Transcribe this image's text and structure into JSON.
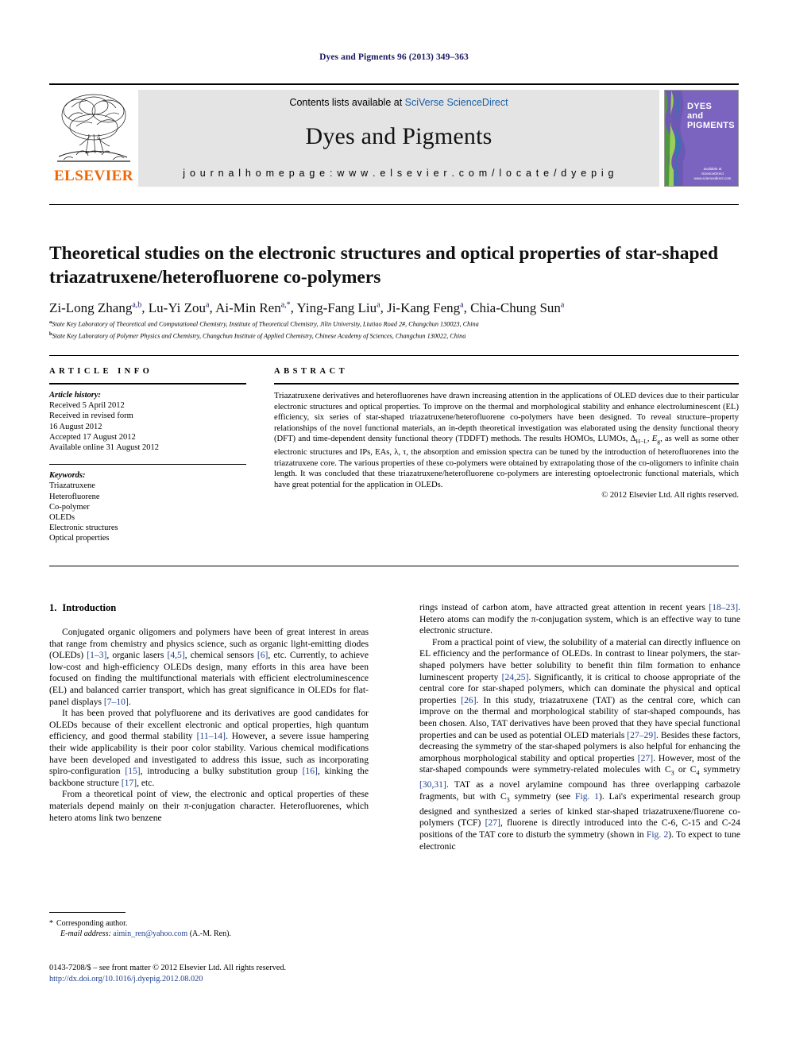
{
  "running_head": "Dyes and Pigments 96 (2013) 349–363",
  "masthead": {
    "publisher_name": "ELSEVIER",
    "contents_prefix": "Contents lists available at ",
    "contents_link": "SciVerse ScienceDirect",
    "journal_title": "Dyes and Pigments",
    "homepage": "j o u r n a l   h o m e p a g e :   w w w . e l s e v i e r . c o m / l o c a t e / d y e p i g",
    "cover": {
      "line1": "DYES",
      "line2": "and",
      "line3": "PIGMENTS",
      "badge_top": "available at",
      "badge_main": "ScienceDirect",
      "badge_url": "www.sciencedirect.com",
      "background_color": "#7b63c0"
    }
  },
  "title": "Theoretical studies on the electronic structures and optical properties of star-shaped triazatruxene/heterofluorene co-polymers",
  "authors": [
    {
      "name": "Zi-Long Zhang",
      "marks": "a,b"
    },
    {
      "name": "Lu-Yi Zou",
      "marks": "a"
    },
    {
      "name": "Ai-Min Ren",
      "marks": "a,*"
    },
    {
      "name": "Ying-Fang Liu",
      "marks": "a"
    },
    {
      "name": "Ji-Kang Feng",
      "marks": "a"
    },
    {
      "name": "Chia-Chung Sun",
      "marks": "a"
    }
  ],
  "affiliations": [
    {
      "mark": "a",
      "text": "State Key Laboratory of Theoretical and Computational Chemistry, Institute of Theoretical Chemistry, Jilin University, Liutiao Road 2#, Changchun 130023, China"
    },
    {
      "mark": "b",
      "text": "State Key Laboratory of Polymer Physics and Chemistry, Changchun Institute of Applied Chemistry, Chinese Academy of Sciences, Changchun 130022, China"
    }
  ],
  "article_info": {
    "heading": "ARTICLE INFO",
    "history_label": "Article history:",
    "history": [
      "Received 5 April 2012",
      "Received in revised form",
      "16 August 2012",
      "Accepted 17 August 2012",
      "Available online 31 August 2012"
    ],
    "keywords_label": "Keywords:",
    "keywords": [
      "Triazatruxene",
      "Heterofluorene",
      "Co-polymer",
      "OLEDs",
      "Electronic structures",
      "Optical properties"
    ]
  },
  "abstract": {
    "heading": "ABSTRACT",
    "text": "Triazatruxene derivatives and heterofluorenes have drawn increasing attention in the applications of OLED devices due to their particular electronic structures and optical properties. To improve on the thermal and morphological stability and enhance electroluminescent (EL) efficiency, six series of star-shaped triazatruxene/heterofluorene co-polymers have been designed. To reveal structure–property relationships of the novel functional materials, an in-depth theoretical investigation was elaborated using the density functional theory (DFT) and time-dependent density functional theory (TDDFT) methods. The results HOMOs, LUMOs, ΔH−L, Eg, as well as some other electronic structures and IPs, EAs, λ, τ, the absorption and emission spectra can be tuned by the introduction of heterofluorenes into the triazatruxene core. The various properties of these co-polymers were obtained by extrapolating those of the co-oligomers to infinite chain length. It was concluded that these triazatruxene/heterofluorene co-polymers are interesting optoelectronic functional materials, which have great potential for the application in OLEDs.",
    "copyright": "© 2012 Elsevier Ltd. All rights reserved."
  },
  "sections": {
    "intro_number": "1.",
    "intro_title": "Introduction"
  },
  "body_left": [
    "Conjugated organic oligomers and polymers have been of great interest in areas that range from chemistry and physics science, such as organic light-emitting diodes (OLEDs) [1–3], organic lasers [4,5], chemical sensors [6], etc. Currently, to achieve low-cost and high-efficiency OLEDs design, many efforts in this area have been focused on finding the multifunctional materials with efficient electroluminescence (EL) and balanced carrier transport, which has great significance in OLEDs for flat-panel displays [7–10].",
    "It has been proved that polyfluorene and its derivatives are good candidates for OLEDs because of their excellent electronic and optical properties, high quantum efficiency, and good thermal stability [11–14]. However, a severe issue hampering their wide applicability is their poor color stability. Various chemical modifications have been developed and investigated to address this issue, such as incorporating spiro-configuration [15], introducing a bulky substitution group [16], kinking the backbone structure [17], etc.",
    "From a theoretical point of view, the electronic and optical properties of these materials depend mainly on their π-conjugation character. Heterofluorenes, which hetero atoms link two benzene"
  ],
  "body_right": [
    "rings instead of carbon atom, have attracted great attention in recent years [18–23]. Hetero atoms can modify the π-conjugation system, which is an effective way to tune electronic structure.",
    "From a practical point of view, the solubility of a material can directly influence on EL efficiency and the performance of OLEDs. In contrast to linear polymers, the star-shaped polymers have better solubility to benefit thin film formation to enhance luminescent property [24,25]. Significantly, it is critical to choose appropriate of the central core for star-shaped polymers, which can dominate the physical and optical properties [26]. In this study, triazatruxene (TAT) as the central core, which can improve on the thermal and morphological stability of star-shaped compounds, has been chosen. Also, TAT derivatives have been proved that they have special functional properties and can be used as potential OLED materials [27–29]. Besides these factors, decreasing the symmetry of the star-shaped polymers is also helpful for enhancing the amorphous morphological stability and optical properties [27]. However, most of the star-shaped compounds were symmetry-related molecules with C3 or C4 symmetry [30,31]. TAT as a novel arylamine compound has three overlapping carbazole fragments, but with C3 symmetry (see Fig. 1). Lai's experimental research group designed and synthesized a series of kinked star-shaped triazatruxene/fluorene co-polymers (TCF) [27], fluorene is directly introduced into the C-6, C-15 and C-24 positions of the TAT core to disturb the symmetry (shown in Fig. 2). To expect to tune electronic"
  ],
  "footnote": {
    "star": "*",
    "corresponding": "Corresponding author.",
    "email_label": "E-mail address:",
    "email": "aimin_ren@yahoo.com",
    "email_suffix": "(A.-M. Ren)."
  },
  "imprint": {
    "line1": "0143-7208/$ – see front matter © 2012 Elsevier Ltd. All rights reserved.",
    "doi": "http://dx.doi.org/10.1016/j.dyepig.2012.08.020"
  },
  "colors": {
    "link": "#1f3f8f",
    "sciencedirect": "#1a5fa8",
    "elsevier_orange": "#ec6707",
    "running_head": "#1b1b64",
    "band_gray": "#e4e4e4"
  }
}
